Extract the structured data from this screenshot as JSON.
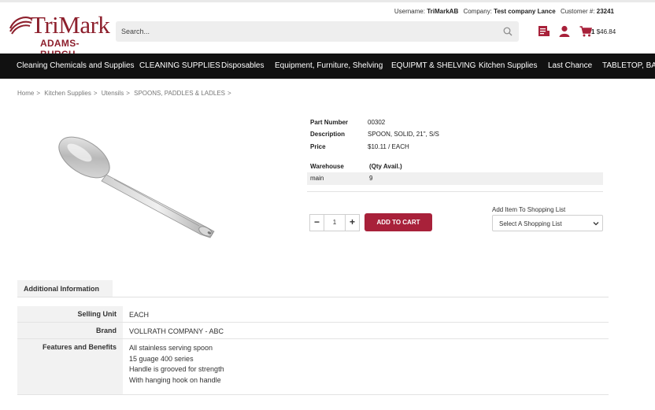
{
  "brand": {
    "name": "TriMark",
    "subname": "ADAMS-BURCH",
    "color": "#8d1f2c"
  },
  "account": {
    "username_label": "Username:",
    "username": "TriMarkAB",
    "company_label": "Company:",
    "company": "Test company Lance",
    "customer_label": "Customer #:",
    "customer": "23241"
  },
  "search": {
    "placeholder": "Search..."
  },
  "header_icons": [
    "orders-icon",
    "user-icon",
    "cart-icon"
  ],
  "cart": {
    "count": "1",
    "total": "$46.84"
  },
  "nav": [
    "Cleaning Chemicals and Supplies",
    "CLEANING SUPPLIES",
    "Disposables",
    "Equipment, Furniture, Shelving",
    "EQUIPMT & SHELVING",
    "Kitchen Supplies",
    "Last Chance",
    "TABLETOP, BAN"
  ],
  "breadcrumb": [
    "Home",
    "Kitchen Supplies",
    "Utensils",
    "SPOONS, PADDLES & LADLES"
  ],
  "product": {
    "part_number_label": "Part Number",
    "part_number": "00302",
    "description_label": "Description",
    "description": "SPOON, SOLID, 21\", S/S",
    "price_label": "Price",
    "price": "$10.11 / EACH",
    "warehouse_label": "Warehouse",
    "qty_label": "(Qty Avail.)",
    "warehouse": "main",
    "qty_avail": "9"
  },
  "purchase": {
    "quantity": "1",
    "minus": "−",
    "plus": "+",
    "add_to_cart": "ADD TO CART",
    "shopping_list_label": "Add Item To Shopping List",
    "shopping_list_selected": "Select A Shopping List"
  },
  "additional": {
    "tab_label": "Additional Information",
    "selling_unit_label": "Selling Unit",
    "selling_unit": "EACH",
    "brand_label": "Brand",
    "brand": "VOLLRATH COMPANY - ABC",
    "features_label": "Features and Benefits",
    "features": [
      "All stainless serving spoon",
      "15 guage 400 series",
      "Handle is grooved for strength",
      "With hanging hook on handle"
    ]
  },
  "colors": {
    "accent": "#a8213a",
    "nav_bg": "#111111"
  }
}
